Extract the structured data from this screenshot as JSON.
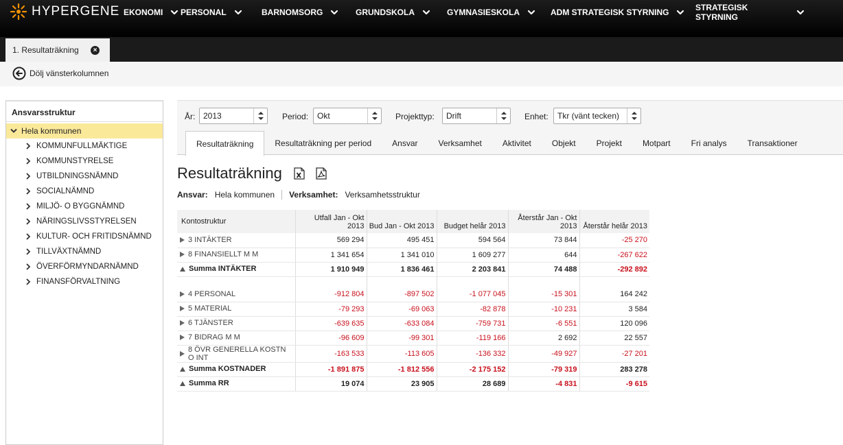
{
  "brand": {
    "name": "HYPERGENE",
    "accent": "#f39200"
  },
  "nav": [
    {
      "label": "EKONOMI"
    },
    {
      "label": "PERSONAL"
    },
    {
      "label": "BARNOMSORG"
    },
    {
      "label": "GRUNDSKOLA"
    },
    {
      "label": "GYMNASIESKOLA"
    },
    {
      "label": "ADM STRATEGISK STYRNING"
    },
    {
      "label": "STRATEGISK STYRNING"
    }
  ],
  "doc_tab": {
    "label": "1. Resultaträkning"
  },
  "toolbar": {
    "hide_column": "Dölj vänsterkolumnen"
  },
  "sidebar": {
    "title": "Ansvarsstruktur",
    "root": "Hela kommunen",
    "items": [
      "KOMMUNFULLMÄKTIGE",
      "KOMMUNSTYRELSE",
      "UTBILDNINGSNÄMND",
      "SOCIALNÄMND",
      "MILJÖ- O BYGGNÄMND",
      "NÄRINGSLIVSSTYRELSEN",
      "KULTUR- OCH FRITIDSNÄMND",
      "TILLVÄXTNÄMND",
      "ÖVERFÖRMYNDARNÄMND",
      "FINANSFÖRVALTNING"
    ]
  },
  "filters": {
    "year_label": "År:",
    "year": "2013",
    "period_label": "Period:",
    "period": "Okt",
    "project_label": "Projekttyp:",
    "project": "Drift",
    "unit_label": "Enhet:",
    "unit": "Tkr (vänt tecken)"
  },
  "tabs": [
    "Resultaträkning",
    "Resultaträkning per period",
    "Ansvar",
    "Verksamhet",
    "Aktivitet",
    "Objekt",
    "Projekt",
    "Motpart",
    "Fri analys",
    "Transaktioner"
  ],
  "page": {
    "title": "Resultaträkning",
    "ansvar_label": "Ansvar:",
    "ansvar": "Hela kommunen",
    "verksamhet_label": "Verksamhet:",
    "verksamhet": "Verksamhetsstruktur"
  },
  "table": {
    "columns": [
      "Kontostruktur",
      "Utfall Jan - Okt 2013",
      "Bud Jan - Okt 2013",
      "Budget helår 2013",
      "Återstår Jan - Okt 2013",
      "Återstår helår 2013"
    ],
    "rows": [
      {
        "label": "3 INTÄKTER",
        "kind": "row",
        "values": [
          "569 294",
          "495 451",
          "594 564",
          "73 844",
          "-25 270"
        ]
      },
      {
        "label": "8 FINANSIELLT M M",
        "kind": "row",
        "values": [
          "1 341 654",
          "1 341 010",
          "1 609 277",
          "644",
          "-267 622"
        ]
      },
      {
        "label": "Summa INTÄKTER",
        "kind": "sum",
        "values": [
          "1 910 949",
          "1 836 461",
          "2 203 841",
          "74 488",
          "-292 892"
        ]
      },
      {
        "label": "",
        "kind": "gap",
        "values": [
          "",
          "",
          "",
          "",
          ""
        ]
      },
      {
        "label": "4 PERSONAL",
        "kind": "row",
        "values": [
          "-912 804",
          "-897 502",
          "-1 077 045",
          "-15 301",
          "164 242"
        ]
      },
      {
        "label": "5 MATERIAL",
        "kind": "row",
        "values": [
          "-79 293",
          "-69 063",
          "-82 878",
          "-10 231",
          "3 584"
        ]
      },
      {
        "label": "6 TJÄNSTER",
        "kind": "row",
        "values": [
          "-639 635",
          "-633 084",
          "-759 731",
          "-6 551",
          "120 096"
        ]
      },
      {
        "label": "7 BIDRAG M M",
        "kind": "row",
        "values": [
          "-96 609",
          "-99 301",
          "-119 166",
          "2 692",
          "22 557"
        ]
      },
      {
        "label": "8 ÖVR GENERELLA KOSTN O INT",
        "kind": "row",
        "values": [
          "-163 533",
          "-113 605",
          "-136 332",
          "-49 927",
          "-27 201"
        ]
      },
      {
        "label": "Summa KOSTNADER",
        "kind": "sum",
        "values": [
          "-1 891 875",
          "-1 812 556",
          "-2 175 152",
          "-79 319",
          "283 278"
        ]
      },
      {
        "label": "Summa RR",
        "kind": "sum",
        "values": [
          "19 074",
          "23 905",
          "28 689",
          "-4 831",
          "-9 615"
        ]
      }
    ]
  },
  "colors": {
    "negative": "#c8101c",
    "selected_row": "#fbe99a"
  }
}
